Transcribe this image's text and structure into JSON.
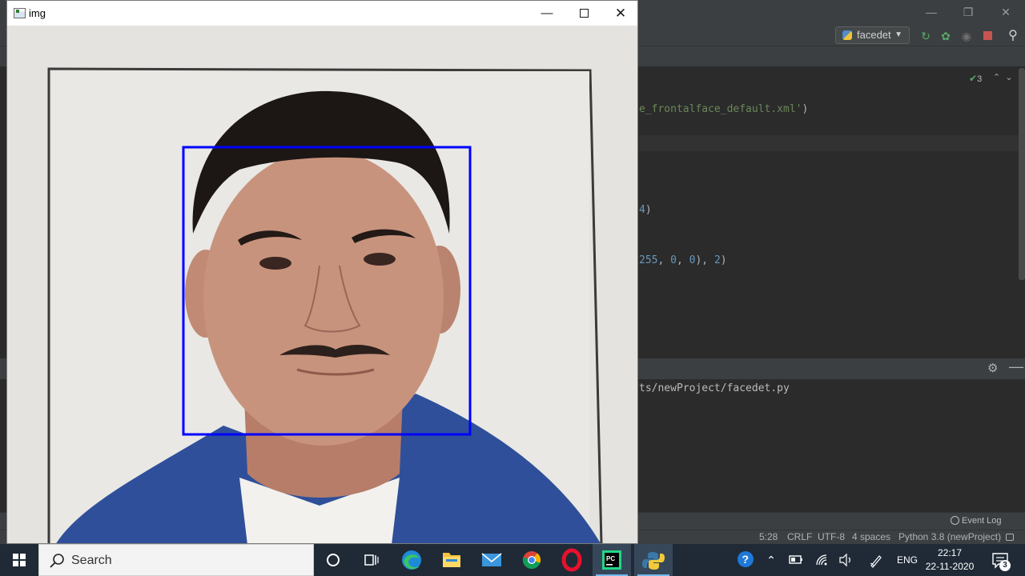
{
  "ide": {
    "run_config": "facedet",
    "inspections_count": "3",
    "code_lines": [
      {
        "pre": "",
        "str": "e_frontalface_default.xml'",
        "post": ")"
      },
      {
        "pre": "",
        "num": "4",
        "post": ")"
      },
      {
        "pre": "",
        "num_a": "255",
        "sep1": ", ",
        "num_b": "0",
        "sep2": ", ",
        "num_c": "0",
        "mid": "), ",
        "num_d": "2",
        "post": ")"
      }
    ],
    "run_output": "ts/newProject/facedet.py",
    "event_log": "Event Log",
    "status": {
      "position": "5:28",
      "line_sep": "CRLF",
      "encoding": "UTF-8",
      "indent": "4 spaces",
      "interpreter": "Python 3.8 (newProject)"
    }
  },
  "img_window": {
    "title": "img",
    "face_box_color": "#0000ff"
  },
  "taskbar": {
    "search_label": "Search",
    "apps": [
      "cortana-icon",
      "task-view-icon",
      "edge-icon",
      "file-explorer-icon",
      "mail-icon",
      "chrome-icon",
      "opera-icon",
      "pycharm-icon",
      "python-icon"
    ],
    "pycharm_label": "PC",
    "language": "ENG",
    "time": "22:17",
    "date": "22-11-2020",
    "notifications": "3"
  }
}
